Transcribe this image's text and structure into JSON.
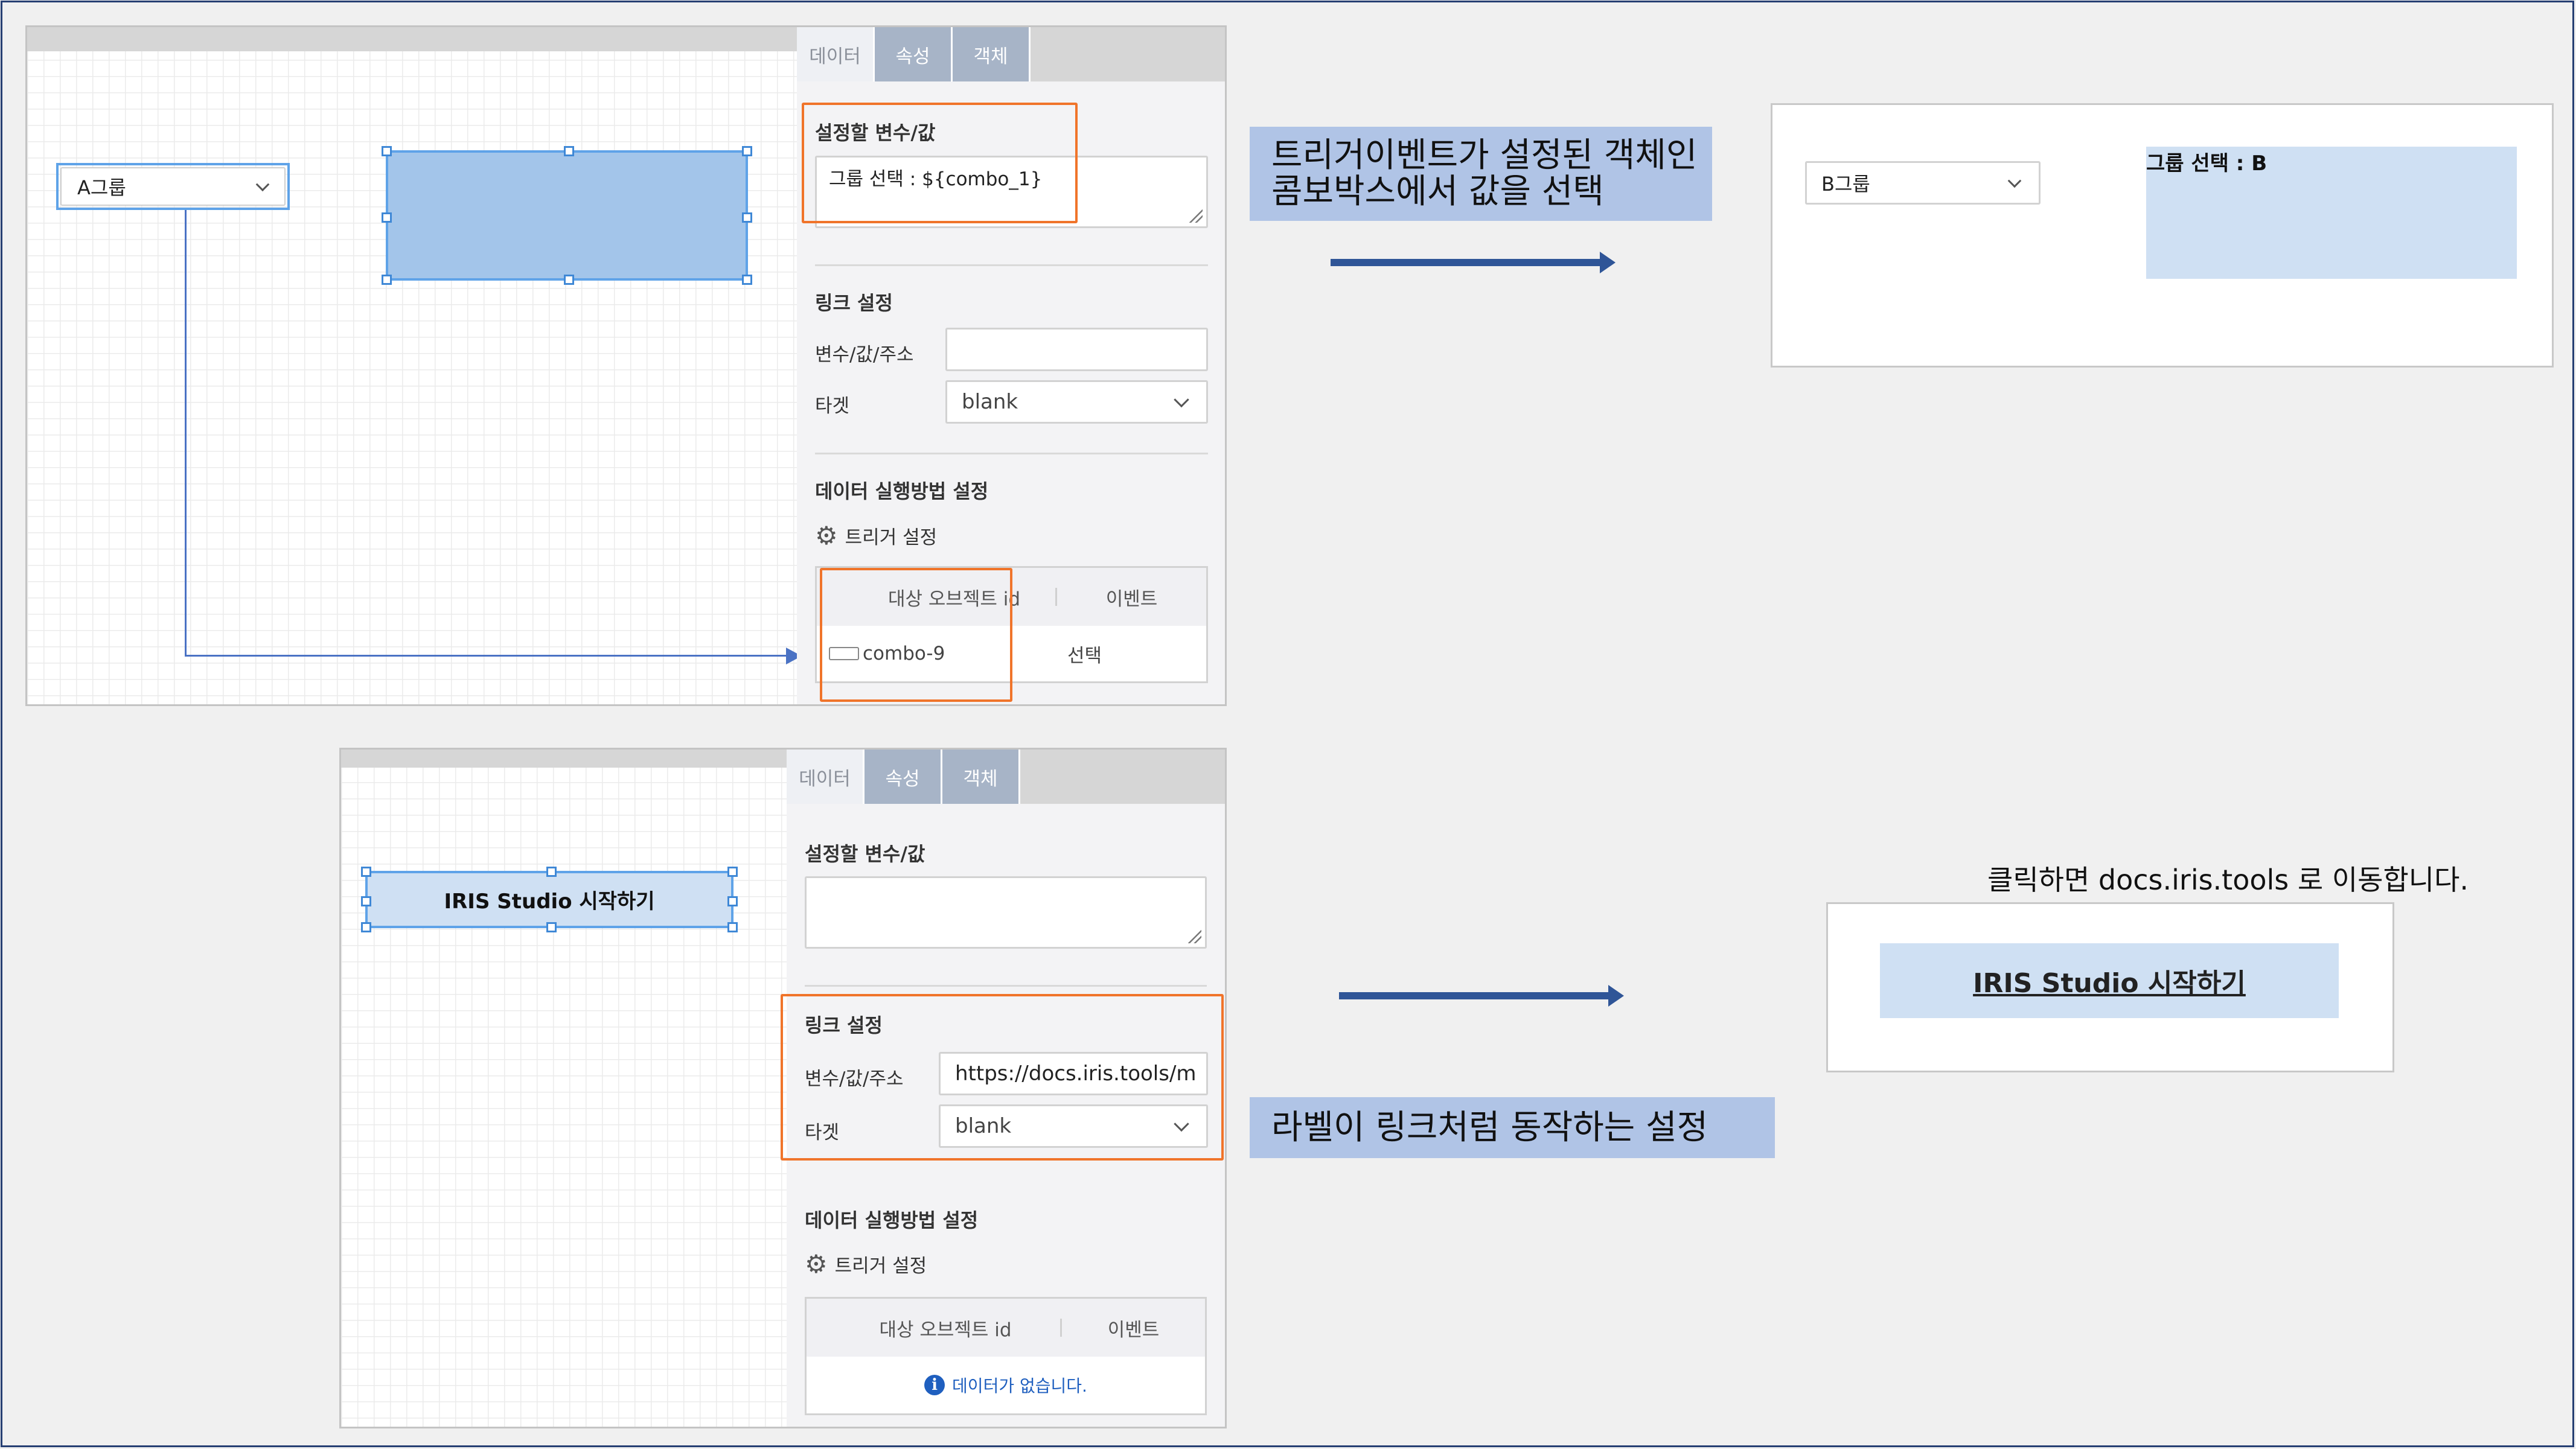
{
  "top_panel": {
    "tabs": [
      {
        "label": "데이터"
      },
      {
        "label": "속성"
      },
      {
        "label": "객체"
      }
    ],
    "var_label": "설정할 변수/값",
    "var_value": "그룹 선택 : ${combo_1}",
    "link_header": "링크 설정",
    "addr_label": "변수/값/주소",
    "addr_value": "",
    "target_label": "타겟",
    "target_value": "blank",
    "exec_header": "데이터 실행방법 설정",
    "trigger_label": "트리거 설정",
    "col_object": "대상 오브젝트 id",
    "col_event": "이벤트",
    "row_object": "combo-9",
    "row_event": "선택"
  },
  "top_canvas": {
    "combo_value": "A그룹"
  },
  "top_result": {
    "combo_value": "B그룹",
    "label_text": "그룹 선택 : B"
  },
  "callout_top": {
    "line1": "트리거이벤트가 설정된 객체인",
    "line2": "콤보박스에서 값을 선택"
  },
  "bottom_panel": {
    "tabs": [
      {
        "label": "데이터"
      },
      {
        "label": "속성"
      },
      {
        "label": "객체"
      }
    ],
    "var_label": "설정할 변수/값",
    "var_value": "",
    "link_header": "링크 설정",
    "addr_label": "변수/값/주소",
    "addr_value": "https://docs.iris.tools/m",
    "target_label": "타겟",
    "target_value": "blank",
    "exec_header": "데이터 실행방법 설정",
    "trigger_label": "트리거 설정",
    "col_object": "대상 오브젝트 id",
    "col_event": "이벤트",
    "empty_message": "데이터가 없습니다."
  },
  "bottom_canvas": {
    "label_text": "IRIS Studio 시작하기"
  },
  "bottom_result": {
    "caption": "클릭하면 docs.iris.tools 로 이동합니다.",
    "link_text": "IRIS Studio 시작하기"
  },
  "callout_bottom": {
    "line1": "라벨이 링크처럼 동작하는 설정"
  },
  "colors": {
    "accent_orange": "#f0742a",
    "arrow_blue": "#2f5597",
    "callout_bg": "#b0c4e6",
    "selection_fill": "#a3c5ea",
    "label_fill": "#cfe0f3"
  }
}
